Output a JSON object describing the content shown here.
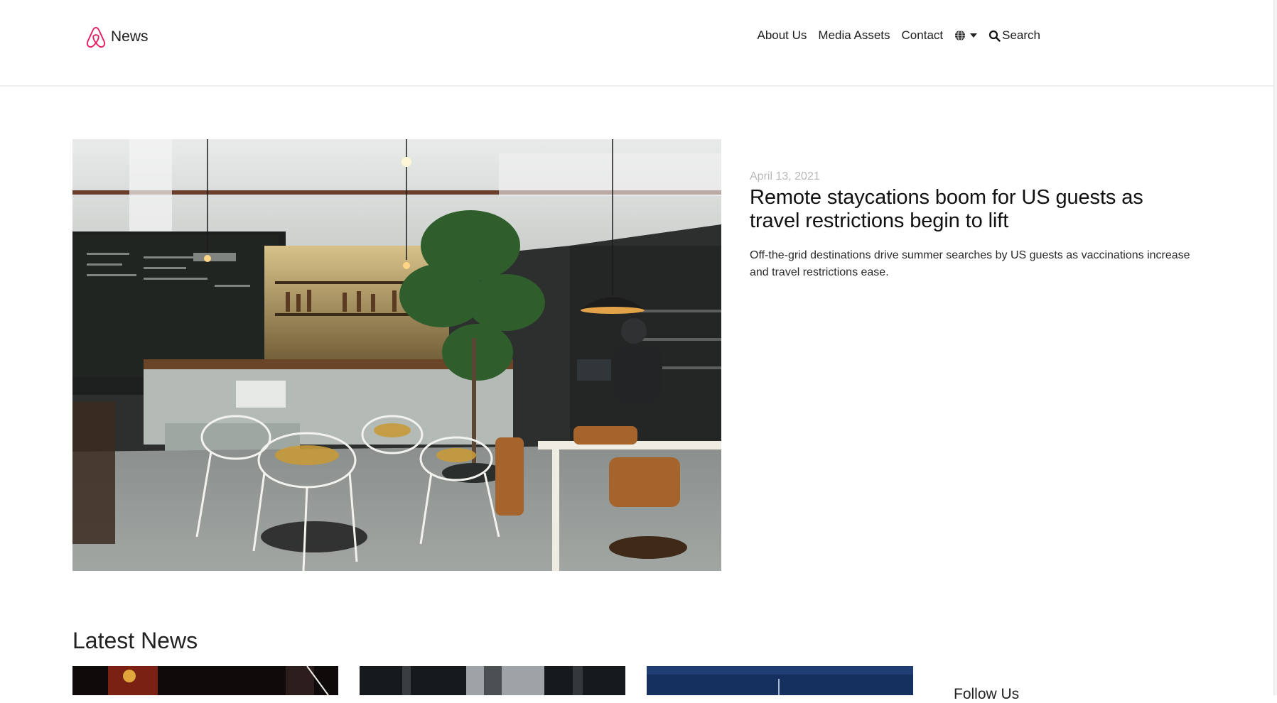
{
  "header": {
    "brand_text": "News",
    "nav": {
      "about": "About Us",
      "media": "Media Assets",
      "contact": "Contact",
      "search": "Search"
    }
  },
  "featured": {
    "date": "April 13, 2021",
    "title": "Remote staycations boom for US guests as travel restrictions begin to lift",
    "summary": "Off-the-grid destinations drive summer searches by US guests as vaccinations increase and travel restrictions ease."
  },
  "latest": {
    "heading": "Latest News"
  },
  "sidebar": {
    "follow_heading": "Follow Us"
  },
  "colors": {
    "brand": "#e31c5f"
  }
}
